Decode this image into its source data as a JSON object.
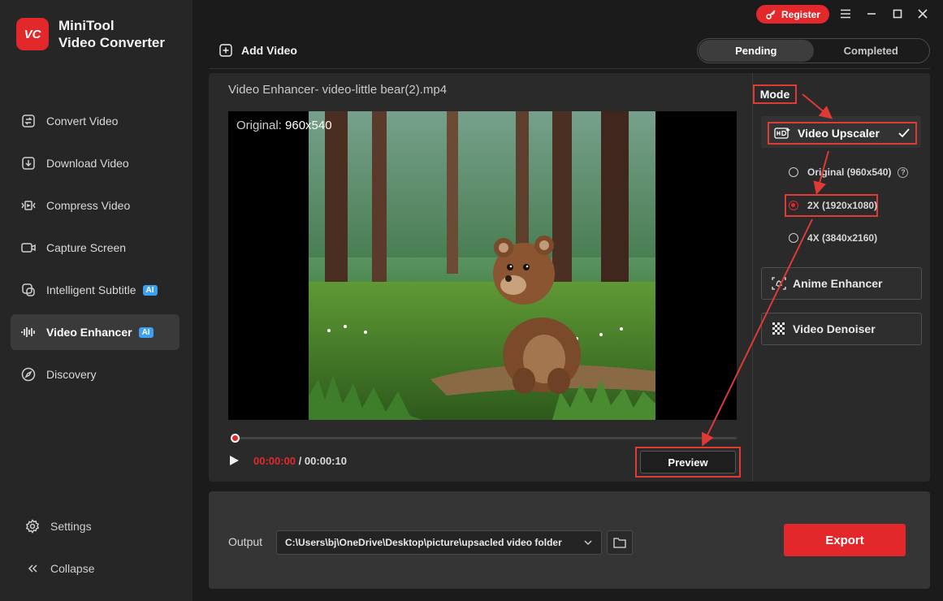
{
  "app": {
    "name_line1": "MiniTool",
    "name_line2": "Video Converter",
    "logo_text": "VC"
  },
  "titlebar": {
    "register_label": "Register"
  },
  "sidebar": {
    "items": [
      {
        "label": "Convert Video",
        "icon": "convert-icon"
      },
      {
        "label": "Download Video",
        "icon": "download-icon"
      },
      {
        "label": "Compress Video",
        "icon": "compress-icon"
      },
      {
        "label": "Capture Screen",
        "icon": "capture-icon"
      },
      {
        "label": "Intelligent Subtitle",
        "icon": "subtitle-icon",
        "badge": "AI"
      },
      {
        "label": "Video Enhancer",
        "icon": "enhancer-icon",
        "badge": "AI",
        "active": true
      },
      {
        "label": "Discovery",
        "icon": "compass-icon"
      }
    ],
    "settings_label": "Settings",
    "collapse_label": "Collapse"
  },
  "toolbar": {
    "add_video_label": "Add Video",
    "tabs": [
      {
        "label": "Pending",
        "active": true
      },
      {
        "label": "Completed"
      }
    ]
  },
  "enhancer": {
    "title": "Video Enhancer- video-little bear(2).mp4",
    "original_prefix": "Original:",
    "original_resolution": "960x540",
    "current_time": "00:00:00",
    "time_separator": "/",
    "total_time": "00:00:10",
    "preview_label": "Preview",
    "mode_label": "Mode",
    "upscaler_label": "Video Upscaler",
    "options": [
      {
        "label": "Original (960x540)",
        "selected": false,
        "help": "?"
      },
      {
        "label": "2X (1920x1080)",
        "selected": true
      },
      {
        "label": "4X (3840x2160)",
        "selected": false
      }
    ],
    "anime_label": "Anime Enhancer",
    "denoiser_label": "Video Denoiser"
  },
  "output": {
    "label": "Output",
    "path": "C:\\Users\\bj\\OneDrive\\Desktop\\picture\\upsacled video folder",
    "export_label": "Export"
  },
  "colors": {
    "accent": "#e3282c",
    "ai_badge": "#3aa0ef",
    "annotation": "#e03a36"
  }
}
